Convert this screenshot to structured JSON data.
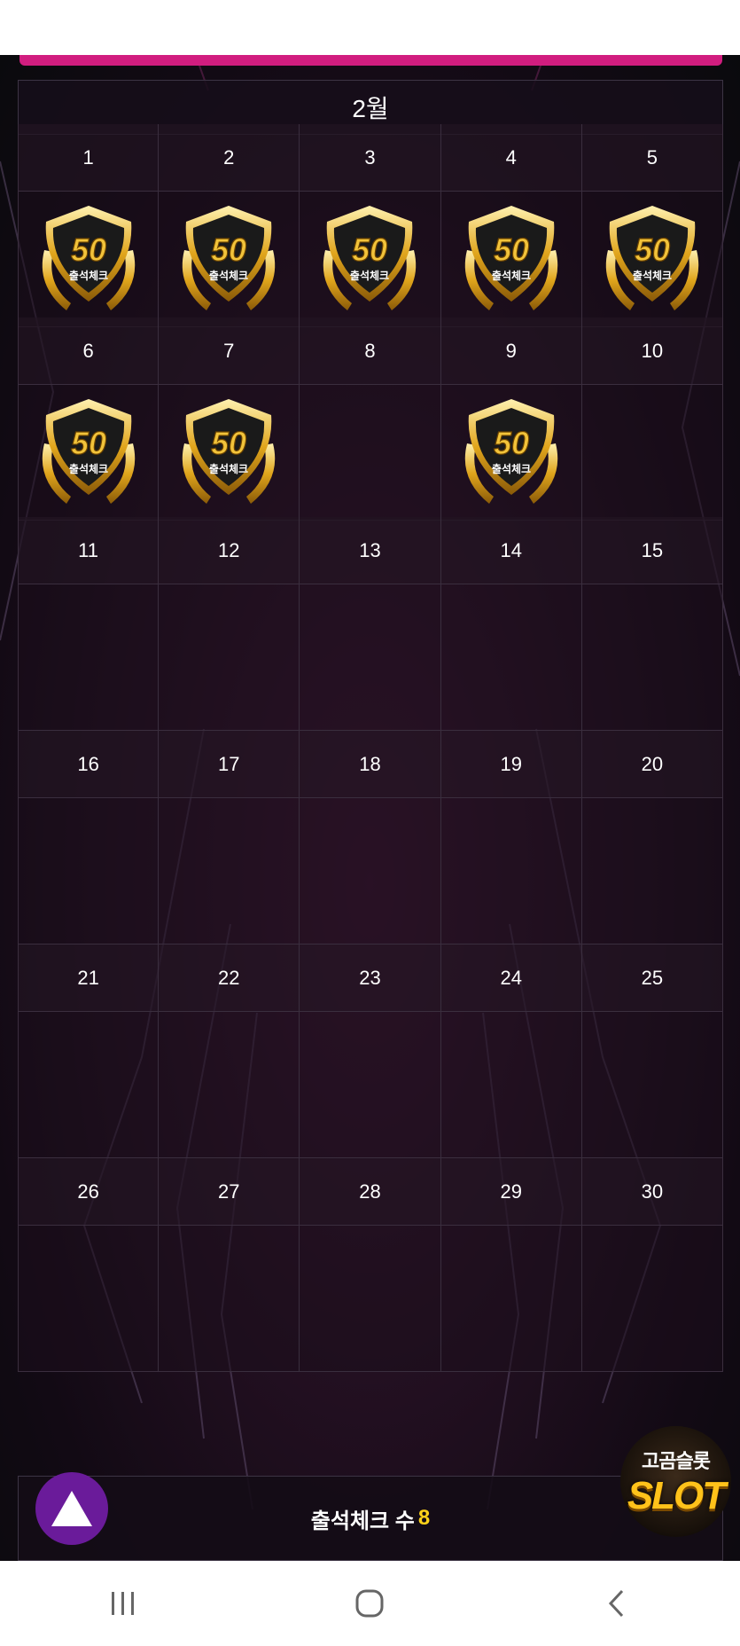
{
  "month_title": "2월",
  "days": [
    {
      "day": "1",
      "checked": true
    },
    {
      "day": "2",
      "checked": true
    },
    {
      "day": "3",
      "checked": true
    },
    {
      "day": "4",
      "checked": true
    },
    {
      "day": "5",
      "checked": true
    },
    {
      "day": "6",
      "checked": true
    },
    {
      "day": "7",
      "checked": true
    },
    {
      "day": "8",
      "checked": false
    },
    {
      "day": "9",
      "checked": true
    },
    {
      "day": "10",
      "checked": false
    },
    {
      "day": "11",
      "checked": false
    },
    {
      "day": "12",
      "checked": false
    },
    {
      "day": "13",
      "checked": false
    },
    {
      "day": "14",
      "checked": false
    },
    {
      "day": "15",
      "checked": false
    },
    {
      "day": "16",
      "checked": false
    },
    {
      "day": "17",
      "checked": false
    },
    {
      "day": "18",
      "checked": false
    },
    {
      "day": "19",
      "checked": false
    },
    {
      "day": "20",
      "checked": false
    },
    {
      "day": "21",
      "checked": false
    },
    {
      "day": "22",
      "checked": false
    },
    {
      "day": "23",
      "checked": false
    },
    {
      "day": "24",
      "checked": false
    },
    {
      "day": "25",
      "checked": false
    },
    {
      "day": "26",
      "checked": false
    },
    {
      "day": "27",
      "checked": false
    },
    {
      "day": "28",
      "checked": false
    },
    {
      "day": "29",
      "checked": false
    },
    {
      "day": "30",
      "checked": false
    }
  ],
  "badge": {
    "number": "50",
    "label": "출석체크"
  },
  "footer": {
    "label": "출석체크 수",
    "count": "8"
  },
  "slot_logo": {
    "line1": "고곰슬롯",
    "line2": "SLOT"
  },
  "icons": {
    "badge": "attendance-medal-icon",
    "up": "triangle-up-icon",
    "recents": "recent-apps-icon",
    "home": "home-icon",
    "back": "back-icon"
  },
  "colors": {
    "accent": "#d11d7f",
    "count": "#ffd21a",
    "up_button": "#6a1b9a"
  }
}
